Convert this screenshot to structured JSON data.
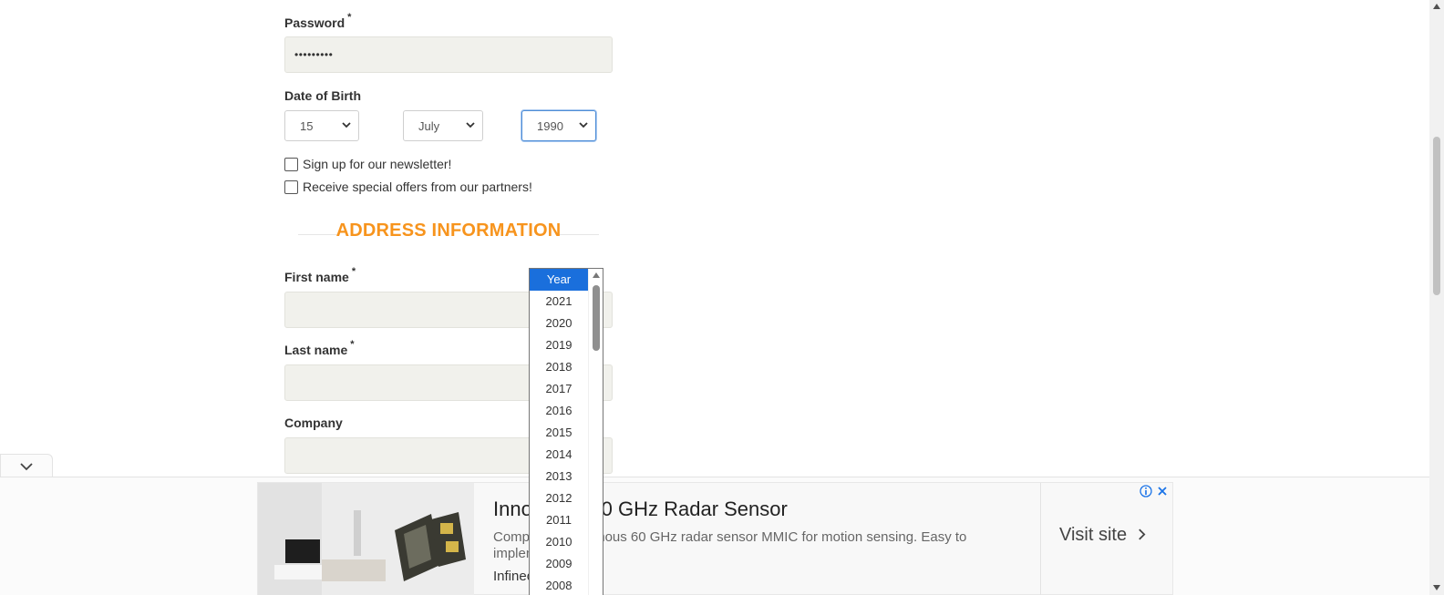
{
  "form": {
    "password": {
      "label": "Password",
      "required": "*",
      "value": "•••••••••"
    },
    "dob": {
      "label": "Date of Birth",
      "day": "15",
      "month": "July",
      "year": "1990"
    },
    "newsletter_label": "Sign up for our newsletter!",
    "offers_label": "Receive special offers from our partners!",
    "address_section_title": "ADDRESS INFORMATION",
    "first_name": {
      "label": "First name",
      "required": "*",
      "value": ""
    },
    "last_name": {
      "label": "Last name",
      "required": "*",
      "value": ""
    },
    "company": {
      "label": "Company",
      "value": ""
    }
  },
  "year_dropdown": {
    "options": [
      "Year",
      "2021",
      "2020",
      "2019",
      "2018",
      "2017",
      "2016",
      "2015",
      "2014",
      "2013",
      "2012",
      "2011",
      "2010",
      "2009",
      "2008"
    ],
    "highlighted": "Year"
  },
  "ad": {
    "title": "Innovative 60 GHz Radar Sensor",
    "description": "Compact autonomous 60 GHz radar sensor MMIC for motion sensing. Easy to implement.",
    "brand": "Infineon",
    "cta": "Visit site",
    "info_icon": "info-icon",
    "close_icon": "close-icon"
  },
  "colors": {
    "accent": "#f7941d",
    "selected_option": "#1a6fdc",
    "input_bg": "#f1f1ec"
  }
}
